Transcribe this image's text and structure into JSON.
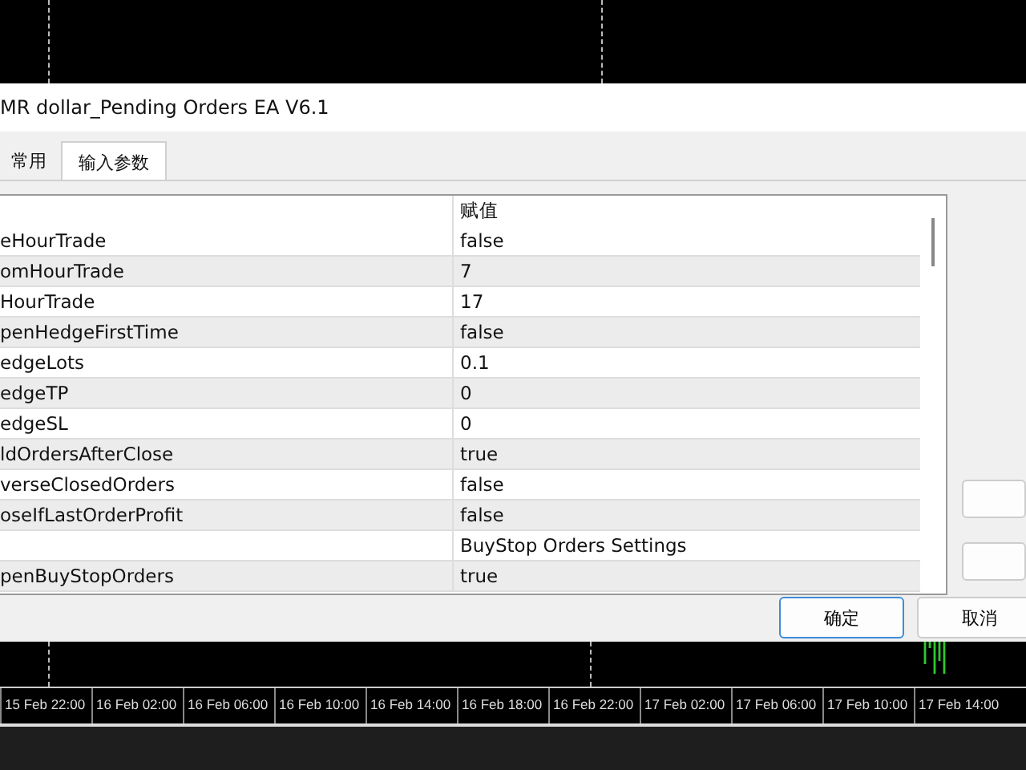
{
  "dialog": {
    "title": "MR dollar_Pending Orders EA V6.1"
  },
  "tabs": [
    {
      "label": "常用",
      "selected": false
    },
    {
      "label": "输入参数",
      "selected": true
    }
  ],
  "table": {
    "columns": [
      "赋值"
    ],
    "rows": [
      {
        "name": "eHourTrade",
        "value": "false"
      },
      {
        "name": "omHourTrade",
        "value": "7"
      },
      {
        "name": "HourTrade",
        "value": "17"
      },
      {
        "name": "penHedgeFirstTime",
        "value": "false"
      },
      {
        "name": "edgeLots",
        "value": "0.1"
      },
      {
        "name": "edgeTP",
        "value": "0"
      },
      {
        "name": "edgeSL",
        "value": "0"
      },
      {
        "name": "ldOrdersAfterClose",
        "value": "true"
      },
      {
        "name": "verseClosedOrders",
        "value": "false"
      },
      {
        "name": "oseIfLastOrderProfit",
        "value": "false"
      },
      {
        "name": "",
        "value": "BuyStop Orders Settings"
      },
      {
        "name": "penBuyStopOrders",
        "value": "true"
      }
    ]
  },
  "buttons": [
    "确定",
    "取消"
  ],
  "chart": {
    "time_labels": [
      "15 Feb 22:00",
      "16 Feb 02:00",
      "16 Feb 06:00",
      "16 Feb 10:00",
      "16 Feb 14:00",
      "16 Feb 18:00",
      "16 Feb 22:00",
      "17 Feb 02:00",
      "17 Feb 06:00",
      "17 Feb 10:00",
      "17 Feb 14:00"
    ]
  }
}
